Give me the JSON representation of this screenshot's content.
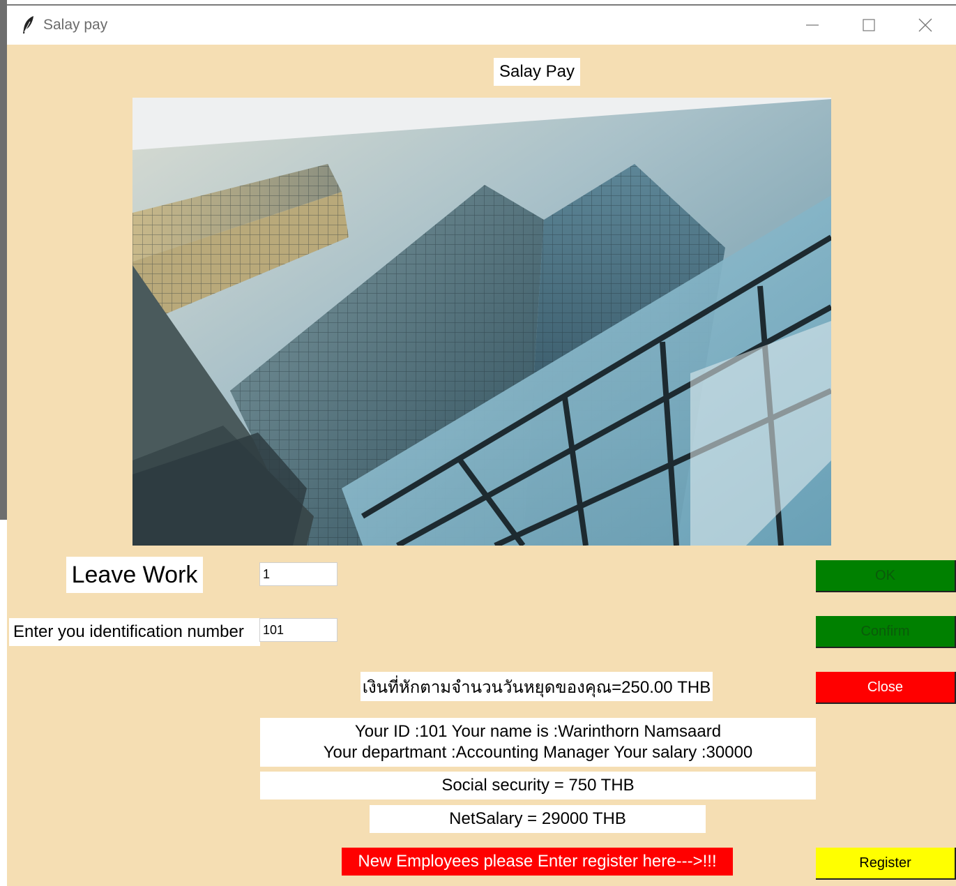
{
  "window": {
    "title": "Salay pay",
    "heading": "Salay Pay"
  },
  "form": {
    "leave_label": "Leave Work",
    "leave_value": "1",
    "id_label": "Enter you identification number",
    "id_value": "101"
  },
  "buttons": {
    "ok": "OK",
    "confirm": "Confirm",
    "close": "Close",
    "register": "Register"
  },
  "results": {
    "deduction": "เงินที่หักตามจำนวนวันหยุดของคุณ=250.00 THB",
    "info_line1": "Your ID :101 Your name is :Warinthorn Namsaard",
    "info_line2": "Your departmant :Accounting Manager Your salary :30000",
    "social_security": "Social security = 750 THB",
    "net_salary": "NetSalary = 29000 THB"
  },
  "register_prompt": "New Employees please Enter register here--->!!!",
  "colors": {
    "background": "#f5deb3",
    "ok_button": "#008000",
    "close_button": "#ff0000",
    "register_button": "#ffff00"
  },
  "icons": {
    "app": "feather-icon",
    "minimize": "minimize-icon",
    "maximize": "maximize-icon",
    "close": "close-icon"
  }
}
